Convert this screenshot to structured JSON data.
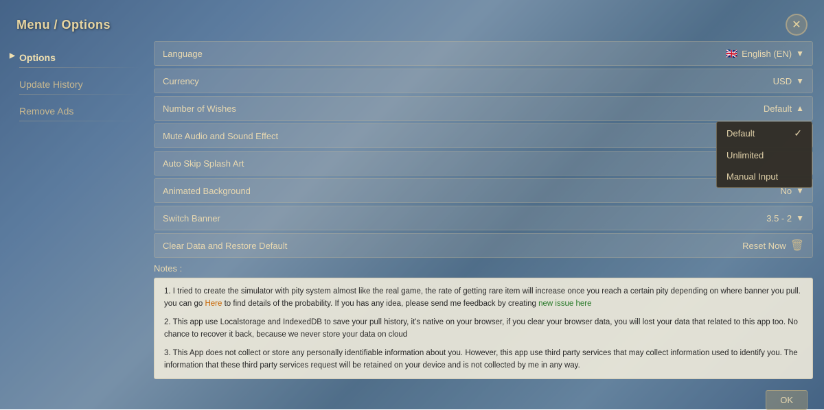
{
  "title": "Menu / Options",
  "close_button_label": "✕",
  "sidebar": {
    "items": [
      {
        "id": "options",
        "label": "Options",
        "active": true
      },
      {
        "id": "update-history",
        "label": "Update History",
        "active": false
      },
      {
        "id": "remove-ads",
        "label": "Remove Ads",
        "active": false
      }
    ]
  },
  "settings": [
    {
      "id": "language",
      "label": "Language",
      "value": "English (EN)",
      "type": "dropdown",
      "flag": "🇬🇧"
    },
    {
      "id": "currency",
      "label": "Currency",
      "value": "USD",
      "type": "dropdown"
    },
    {
      "id": "number-of-wishes",
      "label": "Number of Wishes",
      "value": "Default",
      "type": "dropdown",
      "open": true
    },
    {
      "id": "mute-audio",
      "label": "Mute Audio and Sound Effect",
      "value": "",
      "type": "toggle"
    },
    {
      "id": "auto-skip",
      "label": "Auto Skip Splash Art",
      "value": "",
      "type": "toggle"
    },
    {
      "id": "animated-bg",
      "label": "Animated Background",
      "value": "No",
      "type": "dropdown"
    },
    {
      "id": "switch-banner",
      "label": "Switch Banner",
      "value": "3.5 - 2",
      "type": "dropdown"
    },
    {
      "id": "clear-data",
      "label": "Clear Data and Restore Default",
      "value": "Reset Now",
      "type": "action"
    }
  ],
  "dropdown_open": {
    "items": [
      {
        "label": "Default",
        "selected": true
      },
      {
        "label": "Unlimited",
        "selected": false
      },
      {
        "label": "Manual Input",
        "selected": false
      }
    ]
  },
  "notes": {
    "title": "Notes :",
    "items": [
      {
        "prefix": "I tried to create the simulator with pity system almost like the real game, the rate of getting rare item will increase once you reach a certain pity depending on where banner you pull. you can go ",
        "link1_text": "Here",
        "link1_type": "orange",
        "middle": " to find details of the probability. If you has any idea, please send me feedback by creating ",
        "link2_text": "new issue here",
        "link2_type": "green",
        "suffix": ""
      },
      {
        "text": "This app use Localstorage and IndexedDB to save your pull history, it's native on your browser, if you clear your browser data, you will lost your data that related to this app too. No chance to recover it back, because we never store your data on cloud"
      },
      {
        "text": "This App does not collect or store any personally identifiable information about you. However, this app use third party services that may collect information used to identify you. The information that these third party services request will be retained on your device and is not collected by me in any way."
      }
    ]
  }
}
